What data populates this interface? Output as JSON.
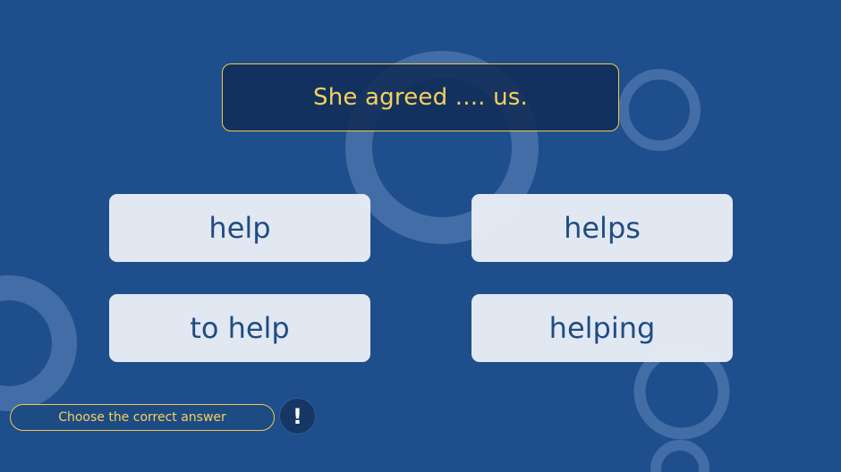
{
  "question": {
    "text": "She agreed .... us."
  },
  "answers": [
    {
      "label": "help"
    },
    {
      "label": "helps"
    },
    {
      "label": "to help"
    },
    {
      "label": "helping"
    }
  ],
  "instruction": {
    "text": "Choose the correct answer"
  },
  "hint": {
    "icon": "exclamation-icon",
    "glyph": "!"
  },
  "colors": {
    "background": "#1f4e8c",
    "accent": "#f2c94c",
    "answer_bg": "#e9eef6",
    "answer_text": "#1f4c82"
  }
}
